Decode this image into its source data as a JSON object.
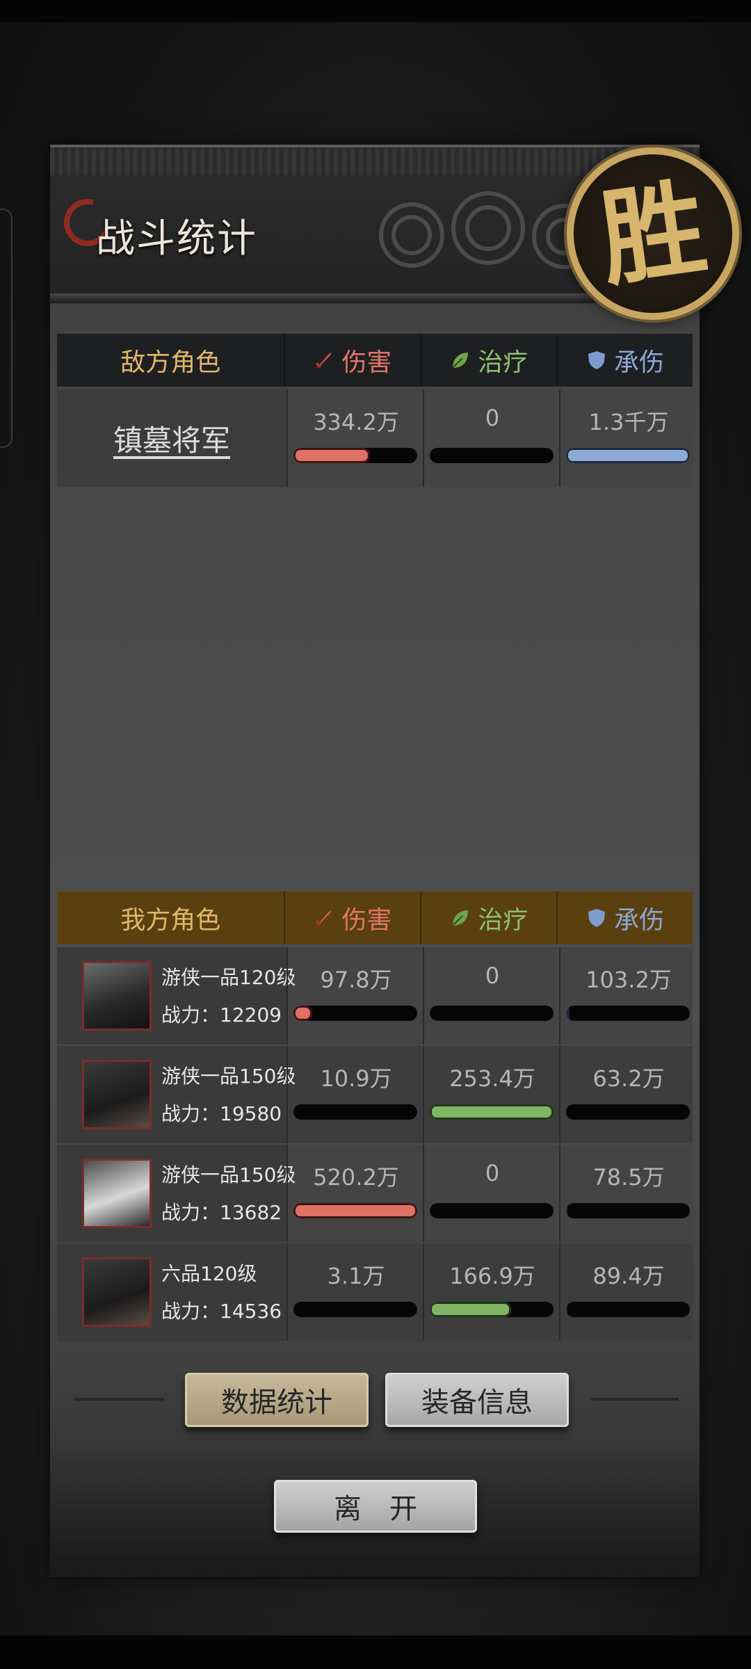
{
  "header": {
    "title": "战斗统计",
    "result_badge": "胜"
  },
  "columns": {
    "damage": "伤害",
    "healing": "治疗",
    "damage_taken": "承伤"
  },
  "enemy": {
    "heading": "敌方角色",
    "rows": [
      {
        "name": "镇墓将军",
        "damage": "334.2万",
        "healing": "0",
        "taken": "1.3千万",
        "damage_fill": 0.62,
        "healing_fill": 0,
        "taken_fill": 1.0
      }
    ]
  },
  "ally": {
    "heading": "我方角色",
    "rows": [
      {
        "class": "游侠一品120级",
        "power": "战力：12209",
        "damage": "97.8万",
        "healing": "0",
        "taken": "103.2万",
        "damage_fill": 0.15,
        "healing_fill": 0,
        "taken_fill": 0.03
      },
      {
        "class": "游侠一品150级",
        "power": "战力：19580",
        "damage": "10.9万",
        "healing": "253.4万",
        "taken": "63.2万",
        "damage_fill": 0,
        "healing_fill": 1.0,
        "taken_fill": 0
      },
      {
        "class": "游侠一品150级",
        "power": "战力：13682",
        "damage": "520.2万",
        "healing": "0",
        "taken": "78.5万",
        "damage_fill": 1.0,
        "healing_fill": 0,
        "taken_fill": 0.01
      },
      {
        "class": "六品120级",
        "power": "战力：14536",
        "damage": "3.1万",
        "healing": "166.9万",
        "taken": "89.4万",
        "damage_fill": 0,
        "healing_fill": 0.66,
        "taken_fill": 0.01
      }
    ]
  },
  "buttons": {
    "stats": "数据统计",
    "equipment": "装备信息",
    "leave": "离开"
  },
  "colors": {
    "damage": "#df7165",
    "healing": "#7fb565",
    "taken": "#8eaad6",
    "gold": "#e3b66a"
  }
}
